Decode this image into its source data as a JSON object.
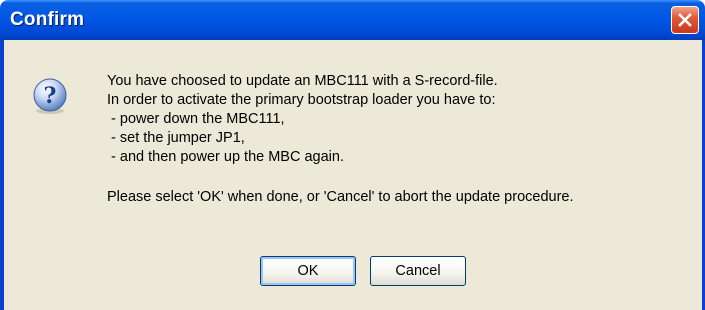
{
  "dialog": {
    "title": "Confirm",
    "icon": "question-icon",
    "message_lines": [
      "You have choosed to update an MBC111 with a S-record-file.",
      "In order to activate the primary bootstrap loader you have to:",
      " - power down the MBC111,",
      " - set the jumper JP1,",
      " - and then power up the MBC again."
    ],
    "prompt": "Please select 'OK' when done, or 'Cancel' to abort the update procedure.",
    "ok_label": "OK",
    "cancel_label": "Cancel"
  },
  "colors": {
    "titlebar": "#0058e6",
    "close_button": "#e2593a",
    "client_background": "#ece9d8"
  }
}
